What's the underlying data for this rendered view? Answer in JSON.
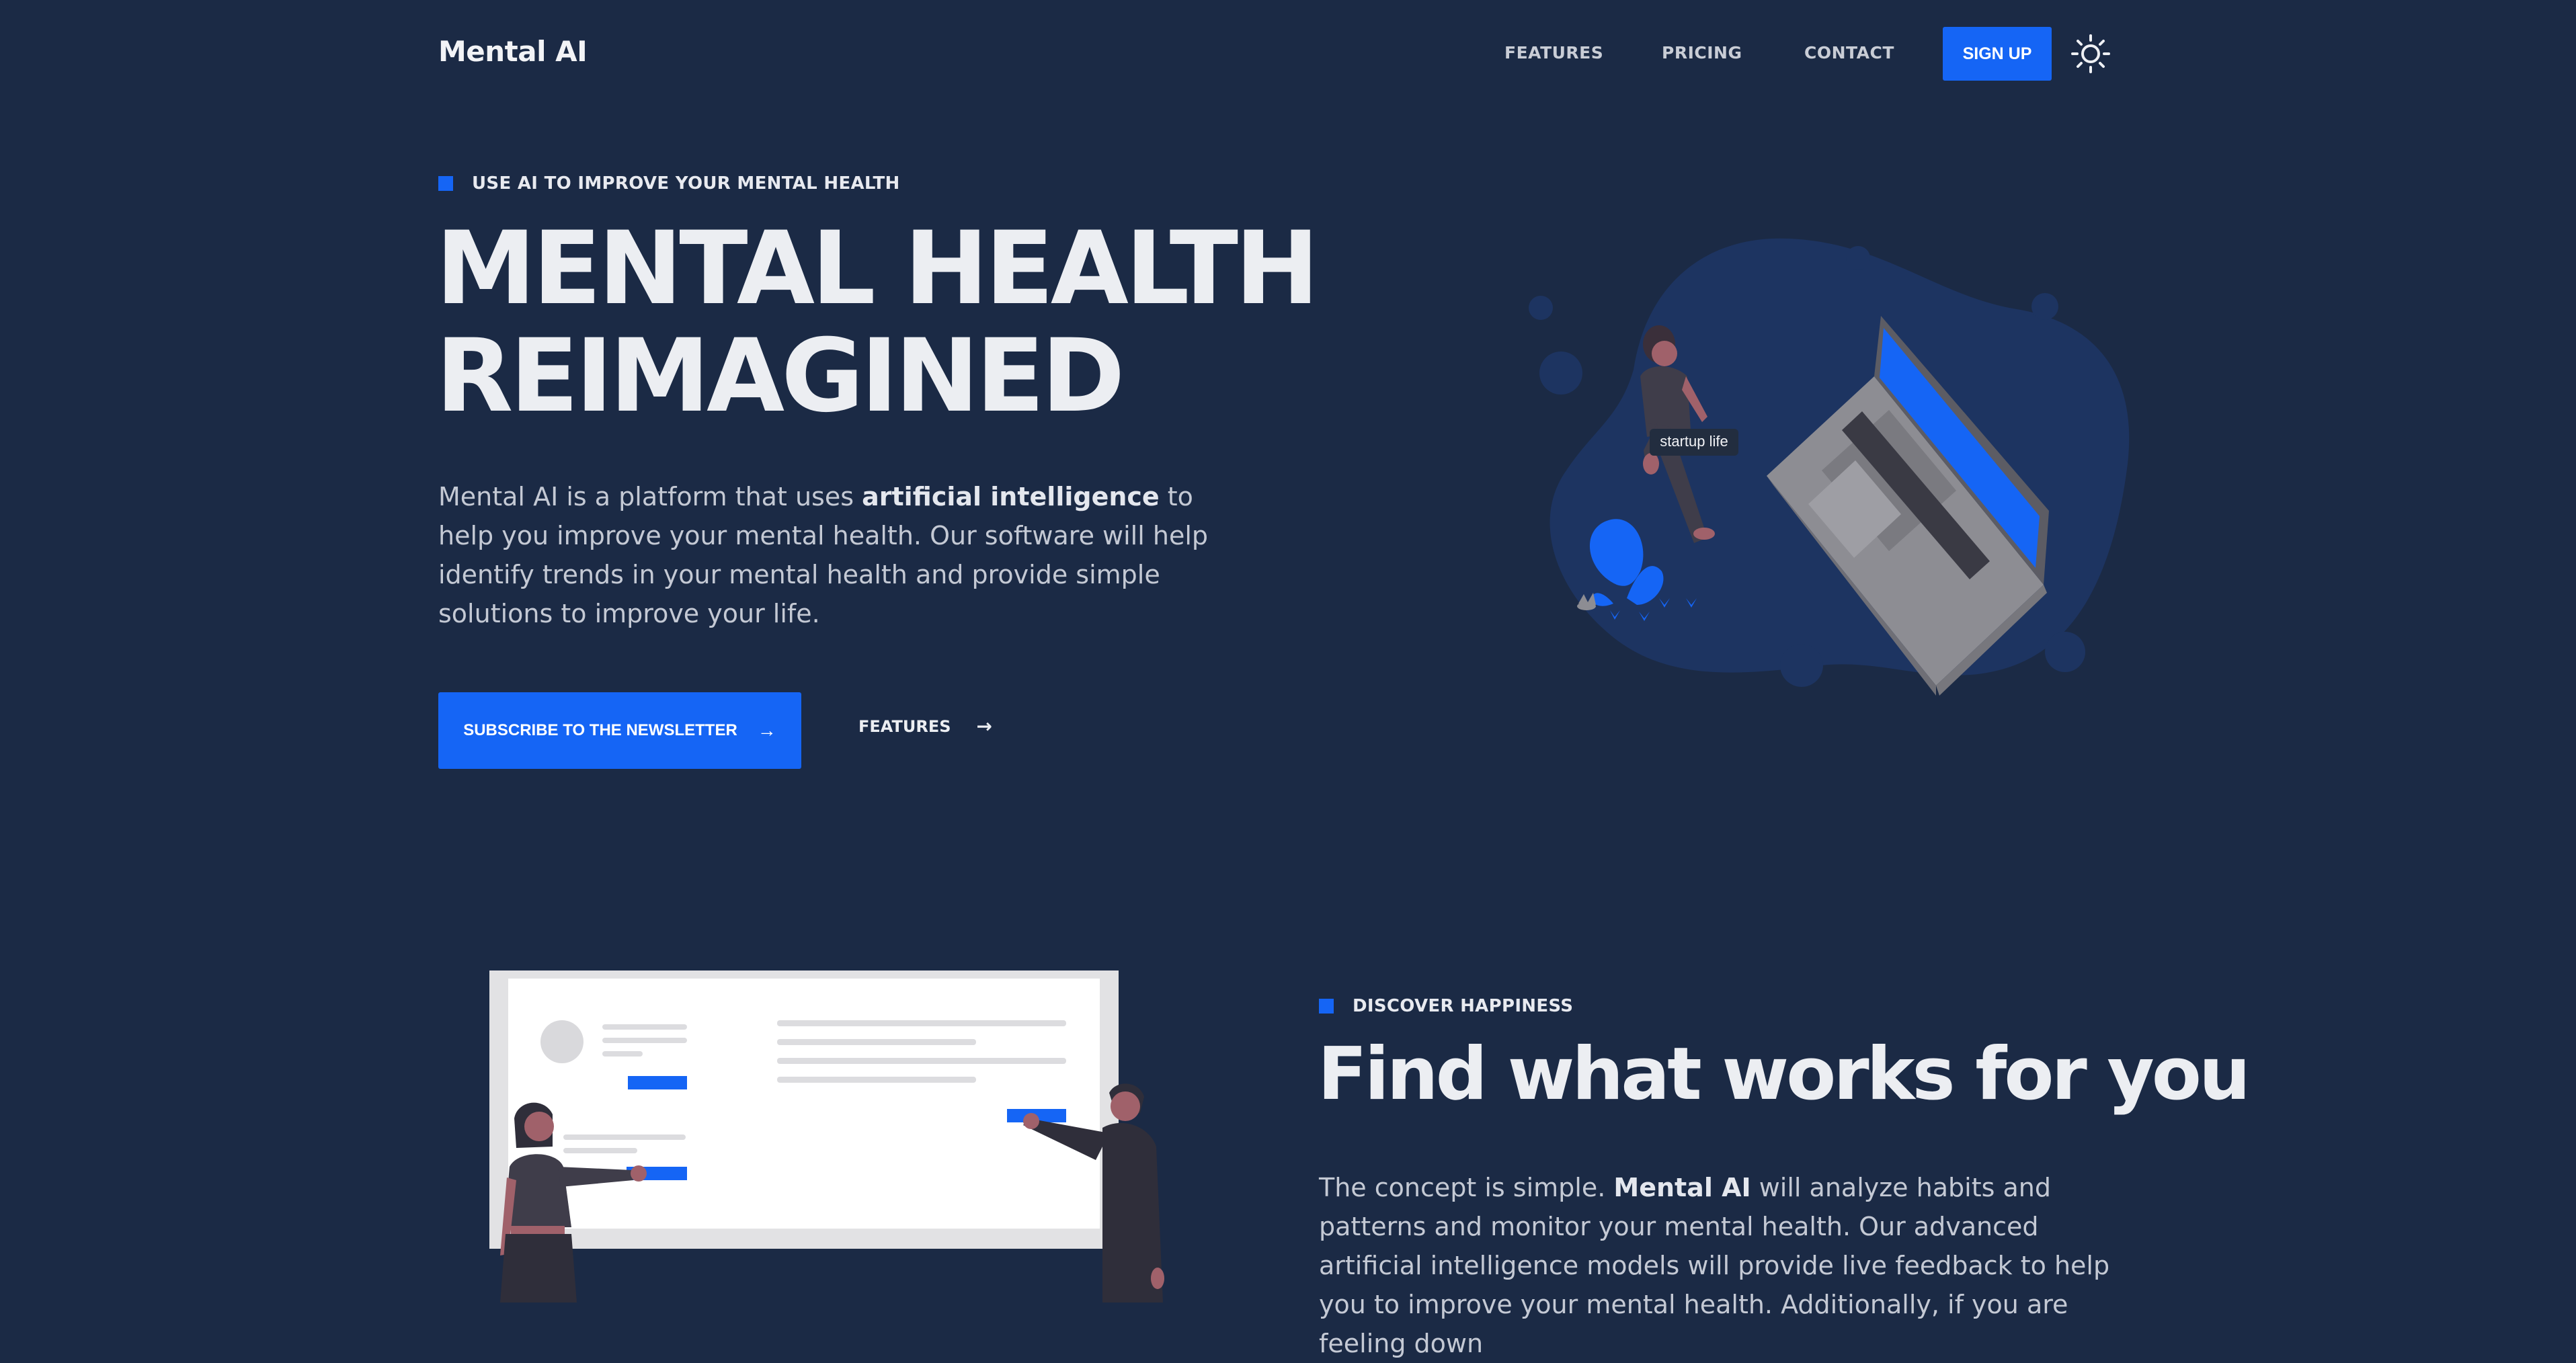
{
  "header": {
    "logo": "Mental AI",
    "nav": [
      {
        "label": "FEATURES"
      },
      {
        "label": "PRICING"
      },
      {
        "label": "CONTACT"
      }
    ],
    "signup_label": "SIGN UP",
    "theme_toggle_icon": "sun-icon"
  },
  "hero": {
    "eyebrow": "USE AI TO IMPROVE YOUR MENTAL HEALTH",
    "title_line1": "MENTAL HEALTH",
    "title_line2": "REIMAGINED",
    "desc_pre": "Mental AI is a platform that uses ",
    "desc_bold": "artificial intelligence",
    "desc_post": " to help you improve your mental health. Our software will help identify trends in your mental health and provide simple solutions to improve your life.",
    "primary_button": "SUBSCRIBE TO THE NEWSLETTER",
    "secondary_button": "FEATURES",
    "arrow": "→",
    "illustration_caption": "startup life"
  },
  "section2": {
    "eyebrow": "DISCOVER HAPPINESS",
    "title": "Find what works for you",
    "desc_pre": "The concept is simple. ",
    "desc_bold": "Mental AI",
    "desc_post": " will analyze habits and patterns and monitor your mental health. Our advanced artificial intelligence models will provide live feedback to help you to improve your mental health. Additionally, if you are feeling down"
  },
  "colors": {
    "background": "#1b2a45",
    "accent": "#1565f5",
    "blob": "#1d3461"
  }
}
